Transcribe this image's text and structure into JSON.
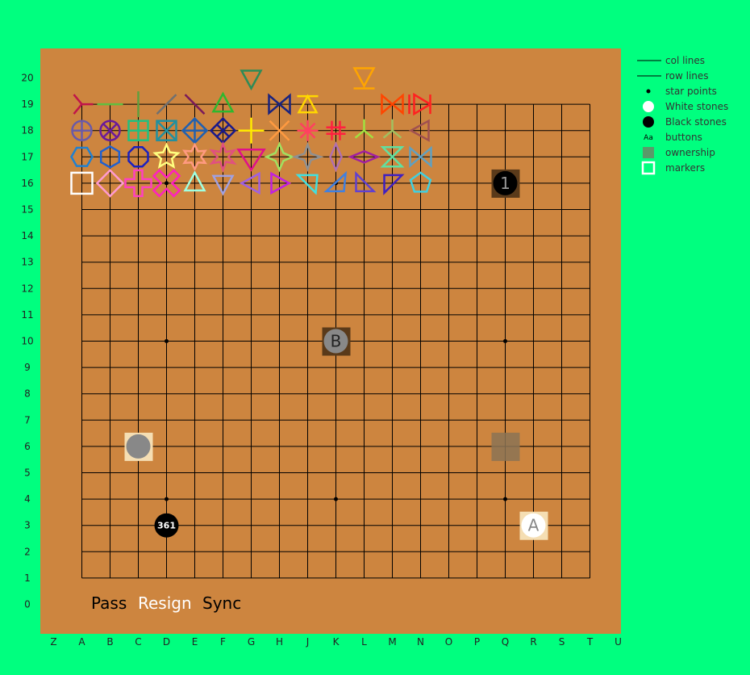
{
  "board": {
    "color": "#cd853f",
    "line_color": "#000000",
    "columns": [
      "Z",
      "A",
      "B",
      "C",
      "D",
      "E",
      "F",
      "G",
      "H",
      "J",
      "K",
      "L",
      "M",
      "N",
      "O",
      "P",
      "Q",
      "R",
      "S",
      "T",
      "U"
    ],
    "rows": [
      "20",
      "19",
      "18",
      "17",
      "16",
      "15",
      "14",
      "13",
      "12",
      "11",
      "10",
      "9",
      "8",
      "7",
      "6",
      "5",
      "4",
      "3",
      "2",
      "1",
      "0"
    ],
    "star_points": [
      "D16",
      "D10",
      "D4",
      "K16",
      "K10",
      "K4",
      "Q16",
      "Q10",
      "Q4"
    ]
  },
  "stones": [
    {
      "point": "Q16",
      "color": "black",
      "label": "1",
      "backdrop": "#5a3a1a"
    },
    {
      "point": "K10",
      "color": "gray",
      "label": "B",
      "backdrop": "#5a3a1a"
    },
    {
      "point": "C6",
      "color": "gray",
      "label": "",
      "backdrop": "#f5deb3"
    },
    {
      "point": "D3",
      "color": "black",
      "label": "361",
      "backdrop": ""
    },
    {
      "point": "R3",
      "color": "white",
      "label": "A",
      "backdrop": "#f5deb3"
    }
  ],
  "ownership": [
    {
      "point": "Q6",
      "color": "#8b7355"
    }
  ],
  "markers": [
    {
      "point": "A19",
      "shape": "tri-y",
      "color": "#c0144a"
    },
    {
      "point": "B19",
      "shape": "hline",
      "color": "#5fbf3f"
    },
    {
      "point": "C19",
      "shape": "vline",
      "color": "#5f9f3f"
    },
    {
      "point": "D19",
      "shape": "slash",
      "color": "#707070"
    },
    {
      "point": "E19",
      "shape": "backslash",
      "color": "#7a1a5a"
    },
    {
      "point": "F19",
      "shape": "triangle-up",
      "color": "#2eb82e"
    },
    {
      "point": "G20",
      "shape": "triangle-down",
      "color": "#2e8b57"
    },
    {
      "point": "H19",
      "shape": "bowtie",
      "color": "#1a237e"
    },
    {
      "point": "J19",
      "shape": "triangle-up-bar",
      "color": "#ffd700"
    },
    {
      "point": "L20",
      "shape": "triangle-down-bar",
      "color": "#ffa500"
    },
    {
      "point": "M19",
      "shape": "bowtie",
      "color": "#ff4500"
    },
    {
      "point": "N19",
      "shape": "play",
      "color": "#ff2020"
    },
    {
      "point": "A18",
      "shape": "circle-plus",
      "color": "#6a5aa8"
    },
    {
      "point": "B18",
      "shape": "circle-x",
      "color": "#6a1a9a"
    },
    {
      "point": "C18",
      "shape": "square-plus",
      "color": "#20c080"
    },
    {
      "point": "D18",
      "shape": "square-x",
      "color": "#2090a0"
    },
    {
      "point": "E18",
      "shape": "diamond-plus",
      "color": "#2060b0"
    },
    {
      "point": "F18",
      "shape": "diamond-x",
      "color": "#1a1a8a"
    },
    {
      "point": "G18",
      "shape": "plus",
      "color": "#ffea00"
    },
    {
      "point": "H18",
      "shape": "cross",
      "color": "#ff9a40"
    },
    {
      "point": "J18",
      "shape": "asterisk",
      "color": "#ff4060"
    },
    {
      "point": "K18",
      "shape": "hash",
      "color": "#ff2040"
    },
    {
      "point": "L18",
      "shape": "tri-y-down",
      "color": "#a0e040"
    },
    {
      "point": "M18",
      "shape": "tri-y-down",
      "color": "#a0c060"
    },
    {
      "point": "N18",
      "shape": "tri-left",
      "color": "#a05050"
    },
    {
      "point": "A17",
      "shape": "hexagon",
      "color": "#2080d0"
    },
    {
      "point": "B17",
      "shape": "hexagon-flat",
      "color": "#2060d0"
    },
    {
      "point": "C17",
      "shape": "octagon",
      "color": "#1a20c0"
    },
    {
      "point": "D17",
      "shape": "star5",
      "color": "#ffff80"
    },
    {
      "point": "E17",
      "shape": "star6",
      "color": "#ff9a80"
    },
    {
      "point": "F17",
      "shape": "star6-tall",
      "color": "#e05080"
    },
    {
      "point": "G17",
      "shape": "triangle-down-big",
      "color": "#e0108a"
    },
    {
      "point": "H17",
      "shape": "star4",
      "color": "#a0e060"
    },
    {
      "point": "J17",
      "shape": "star4-wide",
      "color": "#909090"
    },
    {
      "point": "K17",
      "shape": "diamond-tall",
      "color": "#b070b0"
    },
    {
      "point": "L17",
      "shape": "diamond-wide",
      "color": "#a020a0"
    },
    {
      "point": "M17",
      "shape": "hourglass",
      "color": "#60e0a0"
    },
    {
      "point": "N17",
      "shape": "bowtie",
      "color": "#60a0c0"
    },
    {
      "point": "A16",
      "shape": "square",
      "color": "#ffffff"
    },
    {
      "point": "B16",
      "shape": "diamond",
      "color": "#ff9ad0"
    },
    {
      "point": "C16",
      "shape": "plus-thick",
      "color": "#ff40c0"
    },
    {
      "point": "D16",
      "shape": "x-thick",
      "color": "#ff20c0"
    },
    {
      "point": "E16",
      "shape": "triangle-up",
      "color": "#a0ffe0"
    },
    {
      "point": "F16",
      "shape": "triangle-down",
      "color": "#a0a0e0"
    },
    {
      "point": "G16",
      "shape": "tri-left",
      "color": "#a060e0"
    },
    {
      "point": "H16",
      "shape": "tri-right",
      "color": "#c020e0"
    },
    {
      "point": "J16",
      "shape": "tri-corner-br",
      "color": "#40e0e0"
    },
    {
      "point": "K16",
      "shape": "tri-corner-tl",
      "color": "#4080e0"
    },
    {
      "point": "L16",
      "shape": "tri-corner-bl",
      "color": "#6040d0"
    },
    {
      "point": "M16",
      "shape": "tri-corner-tr",
      "color": "#4020c0"
    },
    {
      "point": "N16",
      "shape": "pentagon",
      "color": "#40d0e0"
    }
  ],
  "buttons": [
    {
      "label": "Pass",
      "color": "#000000"
    },
    {
      "label": "Resign",
      "color": "#ffffff"
    },
    {
      "label": "Sync",
      "color": "#000000"
    }
  ],
  "legend": [
    {
      "label": "col lines",
      "icon": "line",
      "color": "#000000"
    },
    {
      "label": "row lines",
      "icon": "line",
      "color": "#000000"
    },
    {
      "label": "star points",
      "icon": "dot",
      "color": "#000000"
    },
    {
      "label": "White stones",
      "icon": "circle",
      "color": "#ffffff"
    },
    {
      "label": "Black stones",
      "icon": "circle",
      "color": "#000000"
    },
    {
      "label": "buttons",
      "icon": "text",
      "color": "#000000",
      "icon_text": "Aa"
    },
    {
      "label": "ownership",
      "icon": "square",
      "color": "#5a9a6a"
    },
    {
      "label": "markers",
      "icon": "hollow-square",
      "color": "#ffffff"
    }
  ]
}
